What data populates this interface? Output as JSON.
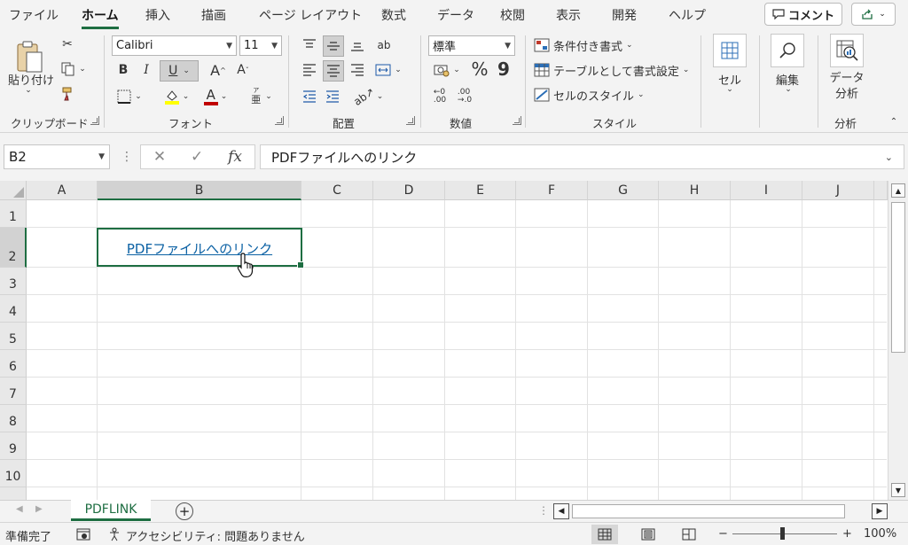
{
  "tabs": [
    {
      "label": "ファイル"
    },
    {
      "label": "ホーム"
    },
    {
      "label": "挿入"
    },
    {
      "label": "描画"
    },
    {
      "label": "ページ レイアウト"
    },
    {
      "label": "数式"
    },
    {
      "label": "データ"
    },
    {
      "label": "校閲"
    },
    {
      "label": "表示"
    },
    {
      "label": "開発"
    },
    {
      "label": "ヘルプ"
    }
  ],
  "comment_button": "コメント",
  "ribbon": {
    "clipboard": {
      "paste_label": "貼り付け",
      "group_label": "クリップボード"
    },
    "font": {
      "font_name": "Calibri",
      "font_size": "11",
      "bold": "B",
      "italic": "I",
      "underline": "U",
      "grow": "A",
      "shrink": "A",
      "font_color": "A",
      "phonetic": "亜",
      "group_label": "フォント"
    },
    "alignment": {
      "group_label": "配置",
      "wrap_text": "ab"
    },
    "number": {
      "format": "標準",
      "percent": "%",
      "comma": "9",
      "group_label": "数値"
    },
    "styles": {
      "conditional_formatting": "条件付き書式",
      "format_as_table": "テーブルとして書式設定",
      "cell_styles": "セルのスタイル",
      "group_label": "スタイル"
    },
    "cells": {
      "label": "セル"
    },
    "editing": {
      "label": "編集"
    },
    "analysis": {
      "label_line1": "データ",
      "label_line2": "分析",
      "group_label": "分析"
    }
  },
  "formula_bar": {
    "name_box": "B2",
    "fx": "fx",
    "content": "PDFファイルへのリンク"
  },
  "grid": {
    "columns": [
      "A",
      "B",
      "C",
      "D",
      "E",
      "F",
      "G",
      "H",
      "I",
      "J"
    ],
    "rows": [
      "1",
      "2",
      "3",
      "4",
      "5",
      "6",
      "7",
      "8",
      "9",
      "10"
    ],
    "selected_cell": "B2",
    "cells": {
      "B2": {
        "text": "PDFファイルへのリンク",
        "type": "hyperlink"
      }
    }
  },
  "sheet_tabs": [
    {
      "name": "PDFLINK",
      "active": true
    }
  ],
  "add_sheet": "+",
  "status_bar": {
    "ready": "準備完了",
    "accessibility": "アクセシビリティ: 問題ありません",
    "zoom_minus": "−",
    "zoom_plus": "+",
    "zoom": "100%"
  },
  "colors": {
    "accent": "#1e6e42",
    "link": "#0b61a4",
    "font_color": "#c00000",
    "highlight": "#ffff00"
  }
}
